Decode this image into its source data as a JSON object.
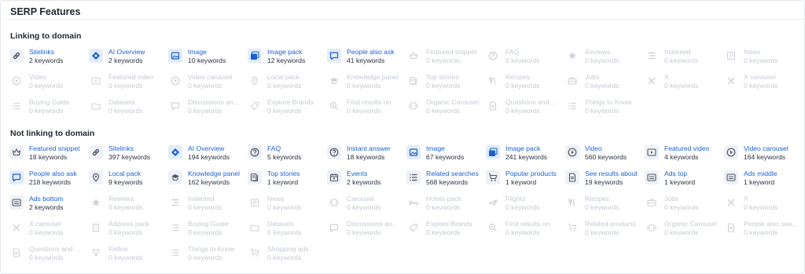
{
  "header": {
    "title": "SERP Features"
  },
  "sections": [
    {
      "title": "Linking to domain",
      "items": [
        {
          "label": "Sitelinks",
          "count": "2 keywords",
          "icon": "link-icon",
          "active": true
        },
        {
          "label": "AI Overview",
          "count": "2 keywords",
          "icon": "diamond-icon",
          "active": true
        },
        {
          "label": "Image",
          "count": "10 keywords",
          "icon": "image-icon",
          "active": true
        },
        {
          "label": "Image pack",
          "count": "12 keywords",
          "icon": "image-pack-icon",
          "active": true
        },
        {
          "label": "People also ask",
          "count": "41 keywords",
          "icon": "comment-icon",
          "active": true
        },
        {
          "label": "Featured snippet",
          "count": "0 keywords",
          "icon": "crown-icon",
          "active": false
        },
        {
          "label": "FAQ",
          "count": "0 keywords",
          "icon": "question-icon",
          "active": false
        },
        {
          "label": "Reviews",
          "count": "0 keywords",
          "icon": "star-icon",
          "active": false
        },
        {
          "label": "Indented",
          "count": "0 keywords",
          "icon": "indent-icon",
          "active": false
        },
        {
          "label": "News",
          "count": "0 keywords",
          "icon": "news-icon",
          "active": false
        },
        {
          "label": "Video",
          "count": "0 keywords",
          "icon": "play-icon",
          "active": false
        },
        {
          "label": "Featured video",
          "count": "0 keywords",
          "icon": "video-frame-icon",
          "active": false
        },
        {
          "label": "Video carousel",
          "count": "0 keywords",
          "icon": "play-icon",
          "active": false
        },
        {
          "label": "Local pack",
          "count": "0 keywords",
          "icon": "pin-icon",
          "active": false
        },
        {
          "label": "Knowledge panel",
          "count": "0 keywords",
          "icon": "graduation-cap-icon",
          "active": false
        },
        {
          "label": "Top stories",
          "count": "0 keywords",
          "icon": "stories-icon",
          "active": false
        },
        {
          "label": "Recipes",
          "count": "0 keywords",
          "icon": "fork-knife-icon",
          "active": false
        },
        {
          "label": "Jobs",
          "count": "0 keywords",
          "icon": "briefcase-icon",
          "active": false
        },
        {
          "label": "X",
          "count": "0 keywords",
          "icon": "x-logo-icon",
          "active": false
        },
        {
          "label": "X carousel",
          "count": "0 keywords",
          "icon": "x-logo-icon",
          "active": false
        },
        {
          "label": "Buying Guide",
          "count": "0 keywords",
          "icon": "list-icon",
          "active": false
        },
        {
          "label": "Datasets",
          "count": "0 keywords",
          "icon": "folder-icon",
          "active": false
        },
        {
          "label": "Discussions an...",
          "count": "0 keywords",
          "icon": "comment-icon",
          "active": false
        },
        {
          "label": "Explore Brands",
          "count": "0 keywords",
          "icon": "tag-icon",
          "active": false
        },
        {
          "label": "Find results on",
          "count": "0 keywords",
          "icon": "search-zoom-icon",
          "active": false
        },
        {
          "label": "Organic Carousel",
          "count": "0 keywords",
          "icon": "carousel-icon",
          "active": false
        },
        {
          "label": "Questions and ...",
          "count": "0 keywords",
          "icon": "document-icon",
          "active": false
        },
        {
          "label": "Things to Know",
          "count": "0 keywords",
          "icon": "list-icon",
          "active": false
        }
      ]
    },
    {
      "title": "Not linking to domain",
      "items": [
        {
          "label": "Featured snippet",
          "count": "18 keywords",
          "icon": "crown-icon",
          "active": true
        },
        {
          "label": "Sitelinks",
          "count": "397 keywords",
          "icon": "link-icon",
          "active": true
        },
        {
          "label": "AI Overview",
          "count": "194 keywords",
          "icon": "diamond-icon",
          "active": true
        },
        {
          "label": "FAQ",
          "count": "5 keywords",
          "icon": "question-icon",
          "active": true
        },
        {
          "label": "Instant answer",
          "count": "18 keywords",
          "icon": "question-icon",
          "active": true
        },
        {
          "label": "Image",
          "count": "67 keywords",
          "icon": "image-icon",
          "active": true
        },
        {
          "label": "Image pack",
          "count": "241 keywords",
          "icon": "image-pack-icon",
          "active": true
        },
        {
          "label": "Video",
          "count": "560 keywords",
          "icon": "play-icon",
          "active": true
        },
        {
          "label": "Featured video",
          "count": "4 keywords",
          "icon": "video-frame-icon",
          "active": true
        },
        {
          "label": "Video carousel",
          "count": "164 keywords",
          "icon": "play-icon",
          "active": true
        },
        {
          "label": "People also ask",
          "count": "218 keywords",
          "icon": "comment-icon",
          "active": true
        },
        {
          "label": "Local pack",
          "count": "9 keywords",
          "icon": "pin-icon",
          "active": true
        },
        {
          "label": "Knowledge panel",
          "count": "162 keywords",
          "icon": "graduation-cap-icon",
          "active": true
        },
        {
          "label": "Top stories",
          "count": "1 keyword",
          "icon": "stories-icon",
          "active": true
        },
        {
          "label": "Events",
          "count": "2 keywords",
          "icon": "calendar-icon",
          "active": true
        },
        {
          "label": "Related searches",
          "count": "568 keywords",
          "icon": "list-icon",
          "active": true
        },
        {
          "label": "Popular products",
          "count": "1 keyword",
          "icon": "cart-icon",
          "active": true
        },
        {
          "label": "See results about",
          "count": "19 keywords",
          "icon": "document-icon",
          "active": true
        },
        {
          "label": "Ads top",
          "count": "1 keyword",
          "icon": "ad-icon",
          "active": true
        },
        {
          "label": "Ads middle",
          "count": "1 keyword",
          "icon": "ad-icon",
          "active": true
        },
        {
          "label": "Ads bottom",
          "count": "2 keywords",
          "icon": "ad-icon",
          "active": true
        },
        {
          "label": "Reviews",
          "count": "0 keywords",
          "icon": "star-icon",
          "active": false
        },
        {
          "label": "Indented",
          "count": "0 keywords",
          "icon": "indent-icon",
          "active": false
        },
        {
          "label": "News",
          "count": "0 keywords",
          "icon": "news-icon",
          "active": false
        },
        {
          "label": "Carousel",
          "count": "0 keywords",
          "icon": "carousel-icon",
          "active": false
        },
        {
          "label": "Hotels pack",
          "count": "0 keywords",
          "icon": "hotel-icon",
          "active": false
        },
        {
          "label": "Flights",
          "count": "0 keywords",
          "icon": "plane-icon",
          "active": false
        },
        {
          "label": "Recipes",
          "count": "0 keywords",
          "icon": "fork-knife-icon",
          "active": false
        },
        {
          "label": "Jobs",
          "count": "0 keywords",
          "icon": "briefcase-icon",
          "active": false
        },
        {
          "label": "X",
          "count": "0 keywords",
          "icon": "x-logo-icon",
          "active": false
        },
        {
          "label": "X carousel",
          "count": "0 keywords",
          "icon": "x-logo-icon",
          "active": false
        },
        {
          "label": "Address pack",
          "count": "0 keywords",
          "icon": "building-icon",
          "active": false
        },
        {
          "label": "Buying Guide",
          "count": "0 keywords",
          "icon": "list-icon",
          "active": false
        },
        {
          "label": "Datasets",
          "count": "0 keywords",
          "icon": "folder-icon",
          "active": false
        },
        {
          "label": "Discussions an...",
          "count": "0 keywords",
          "icon": "comment-icon",
          "active": false
        },
        {
          "label": "Explore Brands",
          "count": "0 keywords",
          "icon": "tag-icon",
          "active": false
        },
        {
          "label": "Find results on",
          "count": "0 keywords",
          "icon": "search-zoom-icon",
          "active": false
        },
        {
          "label": "Related products",
          "count": "0 keywords",
          "icon": "cart-icon",
          "active": false
        },
        {
          "label": "Organic Carousel",
          "count": "0 keywords",
          "icon": "carousel-icon",
          "active": false
        },
        {
          "label": "People also sea...",
          "count": "0 keywords",
          "icon": "document-icon",
          "active": false
        },
        {
          "label": "Questions and ...",
          "count": "0 keywords",
          "icon": "document-icon",
          "active": false
        },
        {
          "label": "Refine",
          "count": "0 keywords",
          "icon": "filter-icon",
          "active": false
        },
        {
          "label": "Things to Know",
          "count": "0 keywords",
          "icon": "list-icon",
          "active": false
        },
        {
          "label": "Shopping ads",
          "count": "0 keywords",
          "icon": "cart-icon",
          "active": false
        }
      ]
    }
  ]
}
